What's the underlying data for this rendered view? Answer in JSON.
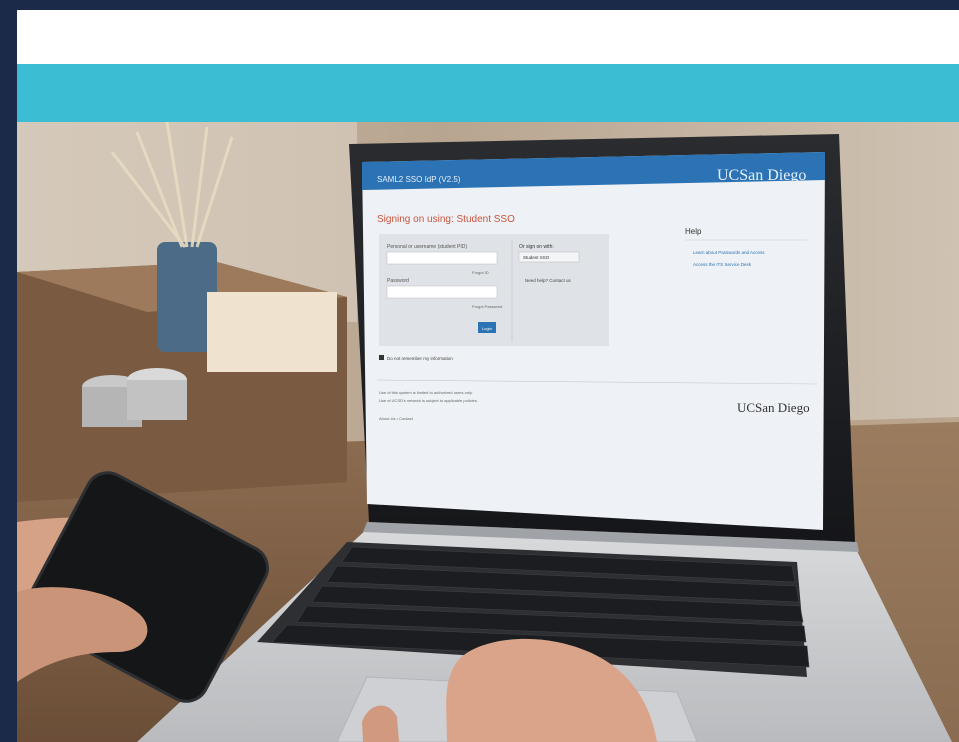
{
  "screen": {
    "header_title": "SAML2 SSO IdP (V2.5)",
    "brand": "UCSan Diego",
    "heading": "Signing on using: Student SSO",
    "username_label": "Personal or username (student PID)",
    "password_label": "Password",
    "forgot_user": "Forgot ID",
    "forgot_pass": "Forgot Password",
    "login_button": "Login",
    "signon_with": "Or sign on with:",
    "signon_option": "Student SSO",
    "help_link": "Need help? Contact us",
    "help_title": "Help",
    "help_items": [
      "Learn about Passwords and Access",
      "Access the ITS Service Desk"
    ],
    "remember": "Do not remember my information",
    "footer_line1": "Use of this system is limited to authorized users only.",
    "footer_line2": "Use of UCSD's network is subject to applicable policies.",
    "footer_links": "About Us • Contact"
  },
  "colors": {
    "page_border": "#1b2a48",
    "banner": "#3bbdd4",
    "screen_header": "#2b73b4",
    "heading_accent": "#c8553d"
  }
}
